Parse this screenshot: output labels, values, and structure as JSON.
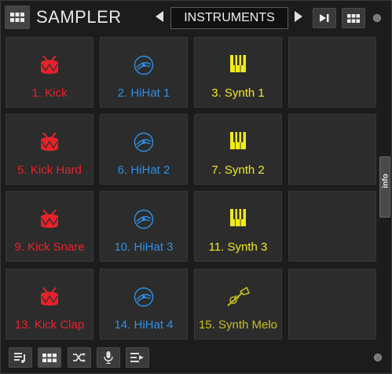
{
  "header": {
    "title": "SAMPLER",
    "bank_name": "INSTRUMENTS"
  },
  "pads": [
    {
      "label": "1. Kick",
      "icon": "drum-icon",
      "color": "#e8222a"
    },
    {
      "label": "2. HiHat 1",
      "icon": "cymbal-icon",
      "color": "#2e8fe6"
    },
    {
      "label": "3. Synth 1",
      "icon": "keys-icon",
      "color": "#f2ea1c"
    },
    {
      "label": "",
      "icon": "",
      "color": ""
    },
    {
      "label": "5. Kick Hard",
      "icon": "drum-icon",
      "color": "#e8222a"
    },
    {
      "label": "6. HiHat 2",
      "icon": "cymbal-icon",
      "color": "#2e8fe6"
    },
    {
      "label": "7. Synth 2",
      "icon": "keys-icon",
      "color": "#f2ea1c"
    },
    {
      "label": "",
      "icon": "",
      "color": ""
    },
    {
      "label": "9. Kick Snare",
      "icon": "drum-icon",
      "color": "#e8222a"
    },
    {
      "label": "10. HiHat 3",
      "icon": "cymbal-icon",
      "color": "#2e8fe6"
    },
    {
      "label": "11. Synth 3",
      "icon": "keys-icon",
      "color": "#f2ea1c"
    },
    {
      "label": "",
      "icon": "",
      "color": ""
    },
    {
      "label": "13. Kick Clap",
      "icon": "drum-icon",
      "color": "#e8222a"
    },
    {
      "label": "14. HiHat 4",
      "icon": "cymbal-icon",
      "color": "#2e8fe6"
    },
    {
      "label": "15. Synth Melo",
      "icon": "trumpet-icon",
      "color": "#c6c01c"
    },
    {
      "label": "",
      "icon": "",
      "color": ""
    }
  ],
  "side_tab": {
    "label": "info"
  },
  "footer": {
    "buttons": [
      "playlist-add-icon",
      "grid-icon",
      "shuffle-icon",
      "microphone-icon",
      "queue-icon"
    ]
  }
}
